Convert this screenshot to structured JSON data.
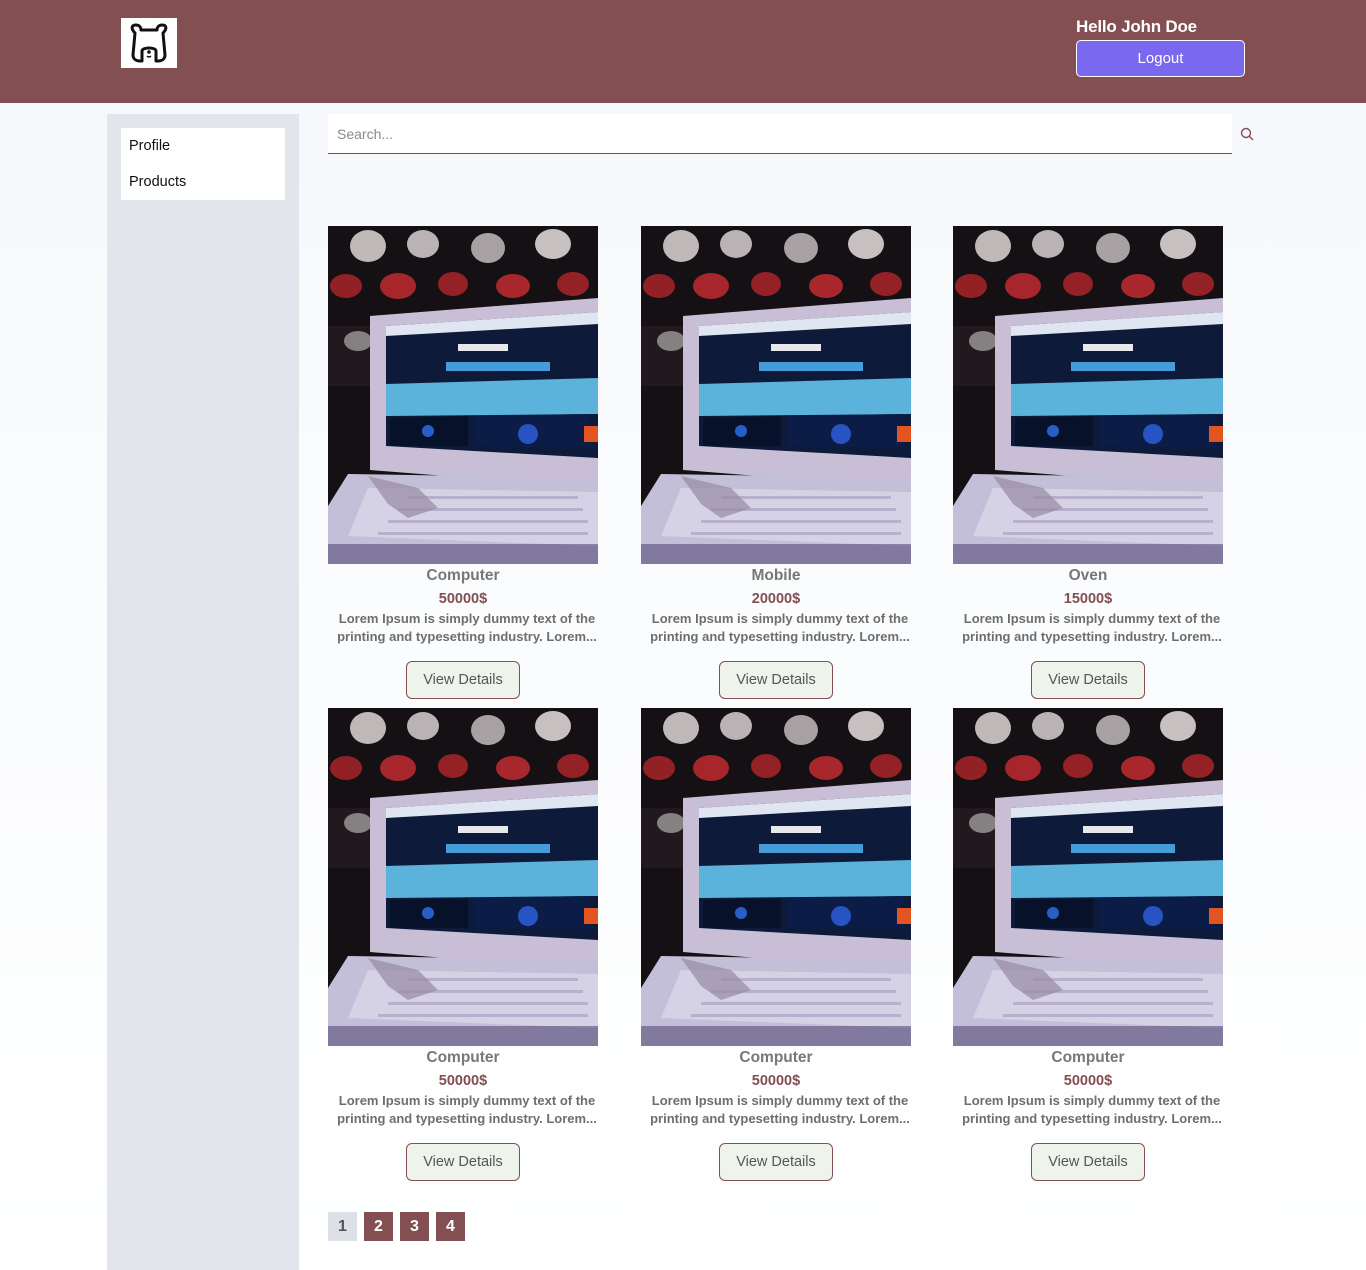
{
  "header": {
    "greeting": "Hello John Doe",
    "logout_label": "Logout",
    "logo_icon": "bear-face-icon",
    "bg_color": "#834f52",
    "button_color": "#7b68ee"
  },
  "sidebar": {
    "items": [
      {
        "label": "Profile"
      },
      {
        "label": "Products"
      }
    ]
  },
  "search": {
    "placeholder": "Search...",
    "value": "",
    "icon": "search-icon"
  },
  "products": [
    {
      "title": "Computer",
      "price": "50000$",
      "desc_line1": "Lorem Ipsum is simply dummy text of the",
      "desc_line2": "printing and typesetting industry. Lorem...",
      "button": "View Details"
    },
    {
      "title": "Mobile",
      "price": "20000$",
      "desc_line1": "Lorem Ipsum is simply dummy text of the",
      "desc_line2": "printing and typesetting industry. Lorem...",
      "button": "View Details"
    },
    {
      "title": "Oven",
      "price": "15000$",
      "desc_line1": "Lorem Ipsum is simply dummy text of the",
      "desc_line2": "printing and typesetting industry. Lorem...",
      "button": "View Details"
    },
    {
      "title": "Computer",
      "price": "50000$",
      "desc_line1": "Lorem Ipsum is simply dummy text of the",
      "desc_line2": "printing and typesetting industry. Lorem...",
      "button": "View Details"
    },
    {
      "title": "Computer",
      "price": "50000$",
      "desc_line1": "Lorem Ipsum is simply dummy text of the",
      "desc_line2": "printing and typesetting industry. Lorem...",
      "button": "View Details"
    },
    {
      "title": "Computer",
      "price": "50000$",
      "desc_line1": "Lorem Ipsum is simply dummy text of the",
      "desc_line2": "printing and typesetting industry. Lorem...",
      "button": "View Details"
    }
  ],
  "pagination": {
    "pages": [
      "1",
      "2",
      "3",
      "4"
    ],
    "current": "1"
  }
}
